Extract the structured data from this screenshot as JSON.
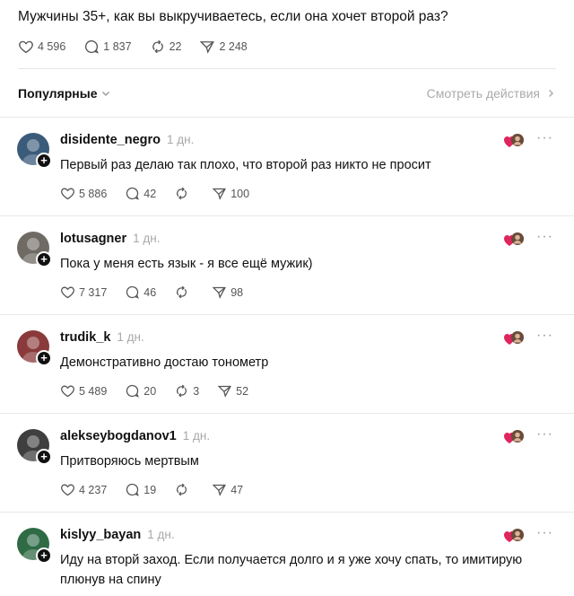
{
  "post": {
    "text": "Мужчины 35+, как вы выкручиваетесь, если она хочет второй раз?",
    "likes": "4 596",
    "replies": "1 837",
    "reposts": "22",
    "shares": "2 248"
  },
  "sort": {
    "label": "Популярные",
    "view_activity": "Смотреть действия"
  },
  "comments": [
    {
      "username": "disidente_negro",
      "ago": "1 дн.",
      "text": "Первый раз делаю так плохо, что второй раз никто не просит",
      "likes": "5 886",
      "replies": "42",
      "reposts": "",
      "shares": "100",
      "avatar_color": "#3b5b7a"
    },
    {
      "username": "lotusagner",
      "ago": "1 дн.",
      "text": "Пока у меня есть язык - я все ещё мужик)",
      "likes": "7 317",
      "replies": "46",
      "reposts": "",
      "shares": "98",
      "avatar_color": "#6f6a64"
    },
    {
      "username": "trudik_k",
      "ago": "1 дн.",
      "text": "Демонстративно достаю тонометр",
      "likes": "5 489",
      "replies": "20",
      "reposts": "3",
      "shares": "52",
      "avatar_color": "#8a3a3a"
    },
    {
      "username": "alekseybogdanov1",
      "ago": "1 дн.",
      "text": "Притворяюсь мертвым",
      "likes": "4 237",
      "replies": "19",
      "reposts": "",
      "shares": "47",
      "avatar_color": "#3f3f3f"
    },
    {
      "username": "kislyy_bayan",
      "ago": "1 дн.",
      "text": "Иду на вторй заход. Если получается долго и я уже хочу спать, то имитирую плюнув на спину",
      "likes": "",
      "replies": "",
      "reposts": "",
      "shares": "",
      "avatar_color": "#2f6b45"
    }
  ],
  "colors": {
    "muted": "#a8a8a8",
    "heart": "#e0245e",
    "text": "#111111"
  },
  "icons": {
    "like": "heart-icon",
    "reply": "comment-bubble-icon",
    "repost": "repost-icon",
    "share": "send-icon",
    "more": "more-dots-icon"
  }
}
